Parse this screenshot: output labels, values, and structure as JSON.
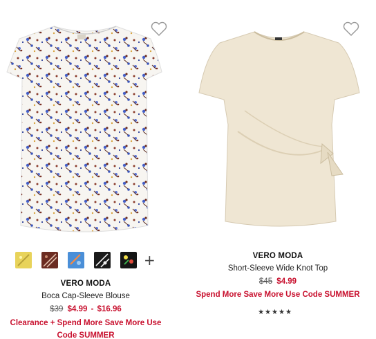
{
  "products": [
    {
      "brand": "VERO MODA",
      "name": "Boca Cap-Sleeve Blouse",
      "original_price": "$39",
      "sale_price": "$4.99",
      "price_separator": "-",
      "sale_price_high": "$16.96",
      "promo": "Clearance + Spend More Save More Use Code SUMMER",
      "swatches": [
        "yellow-floral",
        "brown-floral",
        "blue-floral",
        "black-white-floral",
        "black-multi-floral"
      ],
      "more_swatches_symbol": "+",
      "image_icon": "floral-blouse-image",
      "favorite_icon": "heart-outline-icon"
    },
    {
      "brand": "VERO MODA",
      "name": "Short-Sleeve Wide Knot Top",
      "original_price": "$45",
      "sale_price": "$4.99",
      "promo": "Spend More Save More Use Code SUMMER",
      "rating_stars": "★★★★★",
      "rating_value": 5,
      "image_icon": "knot-top-image",
      "favorite_icon": "heart-outline-icon"
    }
  ],
  "colors": {
    "sale_red": "#c8102e",
    "text": "#222222",
    "cream_top": "#efe6d3"
  }
}
